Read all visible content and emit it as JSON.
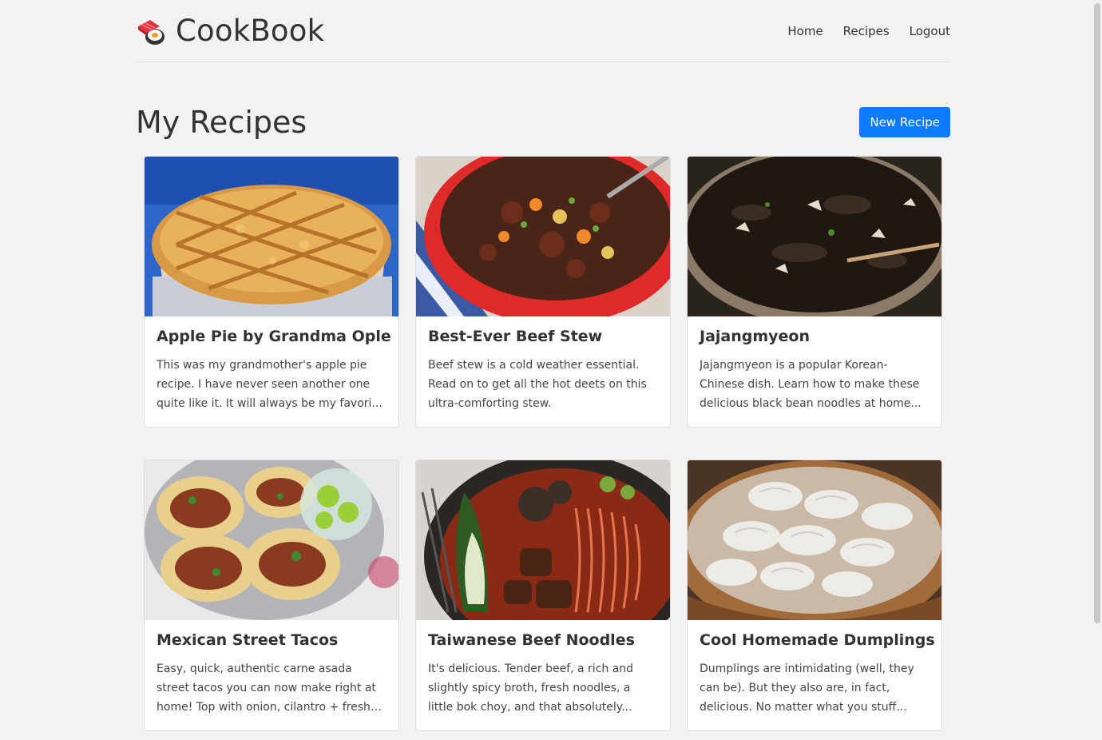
{
  "brand": {
    "name": "CookBook"
  },
  "nav": {
    "home": "Home",
    "recipes": "Recipes",
    "logout": "Logout"
  },
  "page": {
    "title": "My Recipes",
    "new_button": "New Recipe"
  },
  "recipes": [
    {
      "title": "Apple Pie by Grandma Ople",
      "description": "This was my grandmother's apple pie recipe. I have never seen another one quite like it. It will always be my favori..."
    },
    {
      "title": "Best-Ever Beef Stew",
      "description": "Beef stew is a cold weather essential. Read on to get all the hot deets on this ultra-comforting stew."
    },
    {
      "title": "Jajangmyeon",
      "description": "Jajangmyeon is a popular Korean-Chinese dish. Learn how to make these delicious black bean noodles at home..."
    },
    {
      "title": "Mexican Street Tacos",
      "description": "Easy, quick, authentic carne asada street tacos you can now make right at home! Top with onion, cilantro + fresh lime..."
    },
    {
      "title": "Taiwanese Beef Noodles",
      "description": "It's delicious. Tender beef, a rich and slightly spicy broth, fresh noodles, a little bok choy, and that absolutely..."
    },
    {
      "title": "Cool Homemade Dumplings",
      "description": "Dumplings are intimidating (well, they can be). But they also are, in fact, delicious. No matter what you stuff..."
    }
  ]
}
